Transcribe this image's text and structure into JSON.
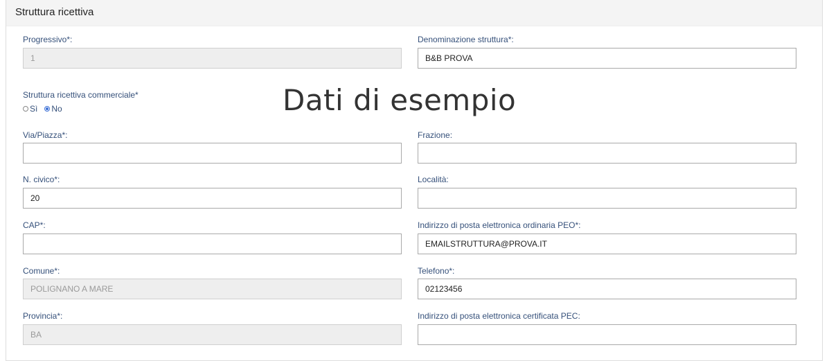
{
  "section": {
    "title": "Struttura ricettiva"
  },
  "watermark": "Dati di esempio",
  "fields": {
    "progressivo": {
      "label": "Progressivo*:",
      "value": "1"
    },
    "denominazione": {
      "label": "Denominazione struttura*:",
      "value": "B&B PROVA"
    },
    "commerciale": {
      "label": "Struttura ricettiva commerciale*",
      "options": [
        "Sì",
        "No"
      ],
      "selected": "No"
    },
    "via": {
      "label": "Via/Piazza*:",
      "value": ""
    },
    "frazione": {
      "label": "Frazione:",
      "value": ""
    },
    "civico": {
      "label": "N. civico*:",
      "value": "20"
    },
    "localita": {
      "label": "Località:",
      "value": ""
    },
    "cap": {
      "label": "CAP*:",
      "value": ""
    },
    "peo": {
      "label": "Indirizzo di posta elettronica ordinaria PEO*:",
      "value": "EMAILSTRUTTURA@PROVA.IT"
    },
    "comune": {
      "label": "Comune*:",
      "value": "POLIGNANO A MARE"
    },
    "telefono": {
      "label": "Telefono*:",
      "value": "02123456"
    },
    "provincia": {
      "label": "Provincia*:",
      "value": "BA"
    },
    "pec": {
      "label": "Indirizzo di posta elettronica certificata PEC:",
      "value": ""
    }
  },
  "colors": {
    "label": "#35507a",
    "radio_selected": "#3b6fd6",
    "disabled_bg": "#eeeeee"
  }
}
